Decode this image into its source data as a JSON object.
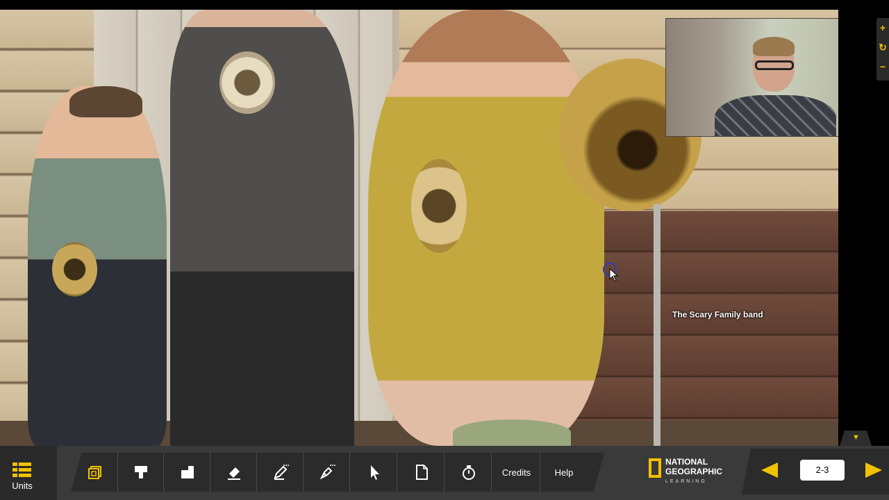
{
  "photo": {
    "caption": "The Scary Family band"
  },
  "side_tools": [
    {
      "icon": "plus-icon",
      "glyph": "+"
    },
    {
      "icon": "rotate-icon",
      "glyph": "↻"
    },
    {
      "icon": "minus-icon",
      "glyph": "−"
    }
  ],
  "toolbar": {
    "units_label": "Units",
    "tools": [
      {
        "name": "layers-tool",
        "icon": "layers-icon"
      },
      {
        "name": "marker-tool",
        "icon": "marker-icon"
      },
      {
        "name": "reveal-tool",
        "icon": "reveal-icon"
      },
      {
        "name": "eraser-tool",
        "icon": "eraser-icon"
      },
      {
        "name": "pen-tool",
        "icon": "pen-icon"
      },
      {
        "name": "highlighter-tool",
        "icon": "highlighter-icon"
      },
      {
        "name": "pointer-tool",
        "icon": "pointer-icon"
      },
      {
        "name": "page-tool",
        "icon": "page-icon"
      },
      {
        "name": "timer-tool",
        "icon": "timer-icon"
      }
    ],
    "credits_label": "Credits",
    "help_label": "Help"
  },
  "brand": {
    "line1": "NATIONAL",
    "line2": "GEOGRAPHIC",
    "line3": "LEARNING",
    "accent_color": "#F2C200"
  },
  "pager": {
    "current_page": "2-3"
  }
}
